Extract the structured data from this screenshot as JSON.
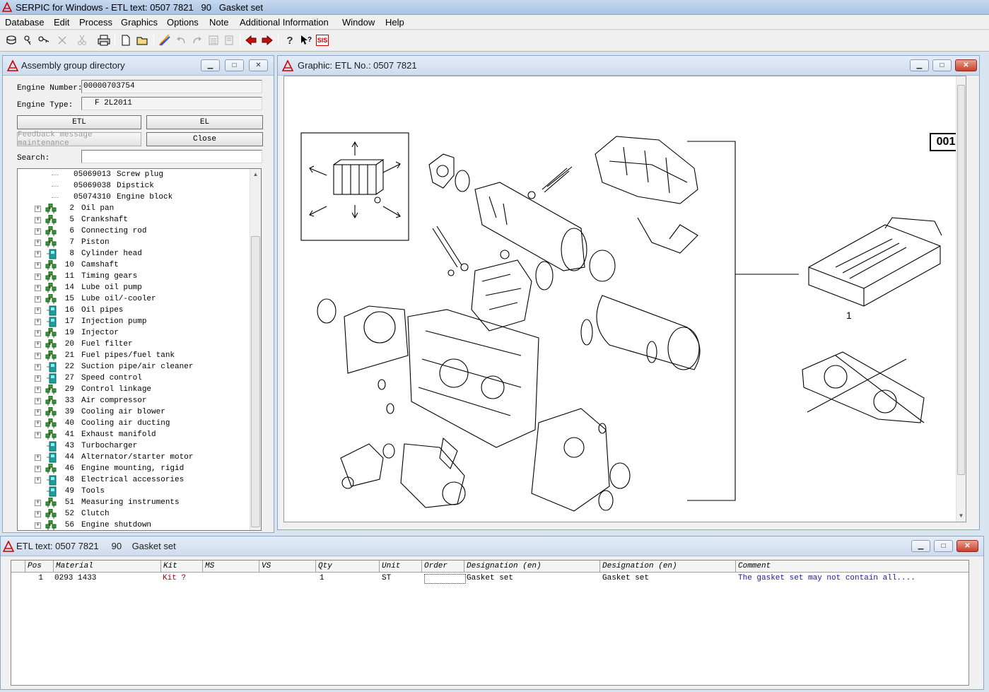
{
  "app": {
    "title": "SERPIC for Windows - ETL text: 0507 7821   90   Gasket set"
  },
  "menu": [
    "Database",
    "Edit",
    "Process",
    "Graphics",
    "Options",
    "Note",
    "Additional Information",
    "Window",
    "Help"
  ],
  "toolbar": {
    "sis_label": "SIS"
  },
  "assembly": {
    "title": "Assembly group directory",
    "engine_number_label": "Engine Number:",
    "engine_number": "00000703754",
    "engine_type_label": "Engine Type:",
    "engine_type": "F 2L2011",
    "btn_etl": "ETL",
    "btn_el": "EL",
    "btn_feedback": "Feedback message maintenance",
    "btn_close": "Close",
    "search_label": "Search:",
    "search_value": "",
    "parts": [
      {
        "num": "05069013",
        "name": "Screw plug"
      },
      {
        "num": "05069038",
        "name": "Dipstick"
      },
      {
        "num": "05074310",
        "name": "Engine block"
      }
    ],
    "groups": [
      {
        "num": "2",
        "name": "Oil pan",
        "icon": "multi"
      },
      {
        "num": "5",
        "name": "Crankshaft",
        "icon": "multi"
      },
      {
        "num": "6",
        "name": "Connecting rod",
        "icon": "multi"
      },
      {
        "num": "7",
        "name": "Piston",
        "icon": "multi"
      },
      {
        "num": "8",
        "name": "Cylinder head",
        "icon": "single"
      },
      {
        "num": "10",
        "name": "Camshaft",
        "icon": "multi"
      },
      {
        "num": "11",
        "name": "Timing gears",
        "icon": "multi"
      },
      {
        "num": "14",
        "name": "Lube oil pump",
        "icon": "multi"
      },
      {
        "num": "15",
        "name": "Lube oil/-cooler",
        "icon": "multi"
      },
      {
        "num": "16",
        "name": "Oil pipes",
        "icon": "single"
      },
      {
        "num": "17",
        "name": "Injection pump",
        "icon": "single"
      },
      {
        "num": "19",
        "name": "Injector",
        "icon": "multi"
      },
      {
        "num": "20",
        "name": "Fuel filter",
        "icon": "multi"
      },
      {
        "num": "21",
        "name": "Fuel pipes/fuel tank",
        "icon": "multi"
      },
      {
        "num": "22",
        "name": "Suction pipe/air cleaner",
        "icon": "single"
      },
      {
        "num": "27",
        "name": "Speed control",
        "icon": "single"
      },
      {
        "num": "29",
        "name": "Control linkage",
        "icon": "multi"
      },
      {
        "num": "33",
        "name": "Air compressor",
        "icon": "multi"
      },
      {
        "num": "39",
        "name": "Cooling air blower",
        "icon": "multi"
      },
      {
        "num": "40",
        "name": "Cooling air ducting",
        "icon": "multi"
      },
      {
        "num": "41",
        "name": "Exhaust manifold",
        "icon": "multi"
      },
      {
        "num": "43",
        "name": "Turbocharger",
        "icon": "single"
      },
      {
        "num": "44",
        "name": "Alternator/starter motor",
        "icon": "single"
      },
      {
        "num": "46",
        "name": "Engine mounting, rigid",
        "icon": "multi"
      },
      {
        "num": "48",
        "name": "Electrical accessories",
        "icon": "single"
      },
      {
        "num": "49",
        "name": "Tools",
        "icon": "single"
      },
      {
        "num": "51",
        "name": "Measuring instruments",
        "icon": "multi"
      },
      {
        "num": "52",
        "name": "Clutch",
        "icon": "multi"
      },
      {
        "num": "56",
        "name": "Engine shutdown",
        "icon": "multi"
      }
    ]
  },
  "graphic": {
    "title": "Graphic: ETL No.: 0507 7821",
    "page_badge": "001",
    "callout": "1"
  },
  "etl": {
    "title": "ETL text: 0507 7821     90    Gasket set",
    "columns": [
      "Pos",
      "Material",
      "Kit",
      "MS",
      "VS",
      "Qty",
      "Unit",
      "Order",
      "Designation  (en)",
      "Designation  (en)",
      "Comment"
    ],
    "rows": [
      {
        "pos": "1",
        "material": "0293 1433",
        "kit": "Kit ?",
        "ms": "",
        "vs": "",
        "qty": "1",
        "unit": "ST",
        "order": "",
        "des1": "Gasket set",
        "des2": "Gasket set",
        "comment": "The gasket set may not contain all...."
      }
    ]
  },
  "colors": {
    "kit_red": "#b00000",
    "comment_blue": "#1a1a9a",
    "tree_icon_green": "#3a9a3a",
    "tree_icon_teal": "#1aa0a0"
  }
}
